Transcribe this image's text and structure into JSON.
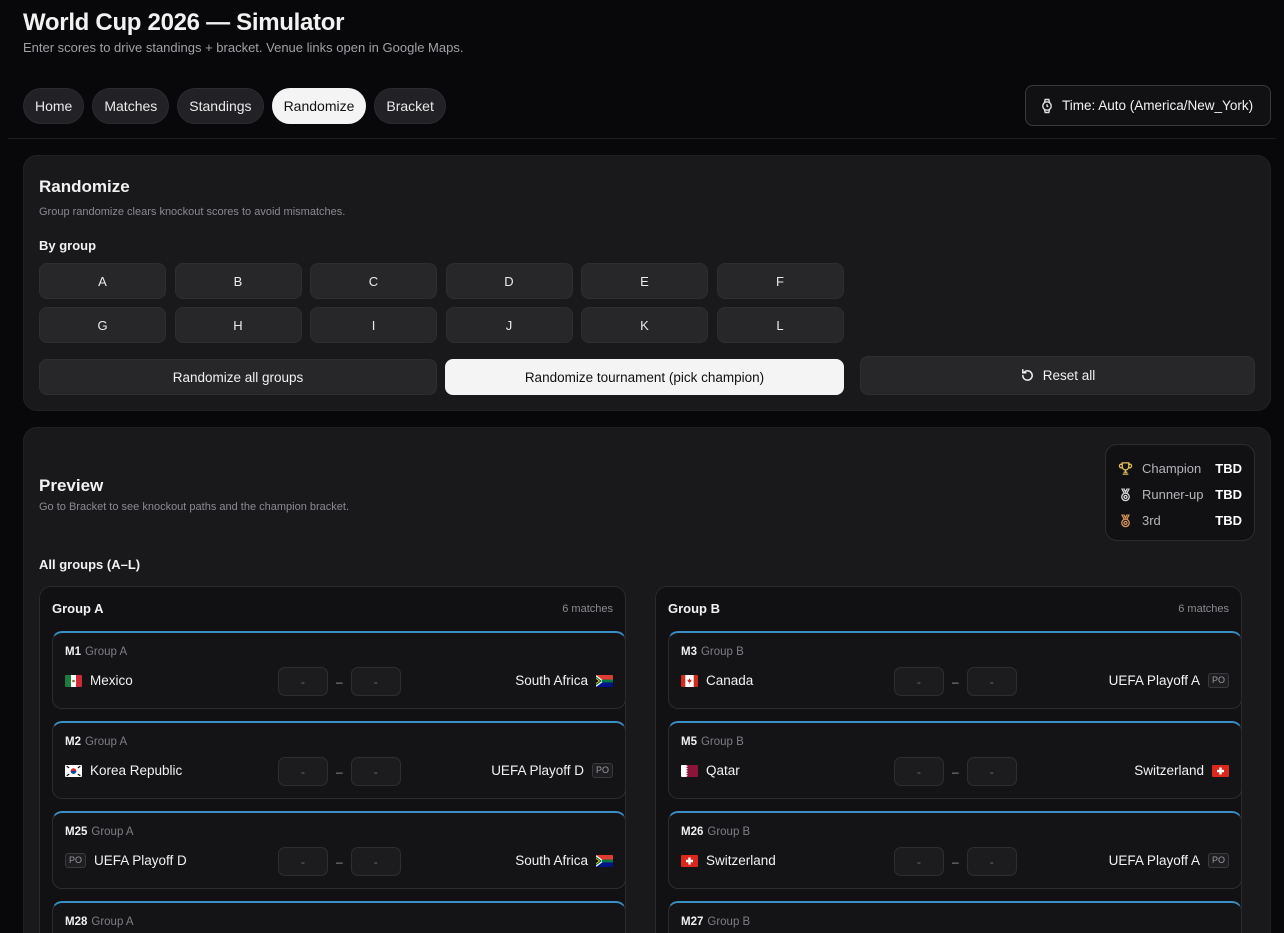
{
  "header": {
    "title": "World Cup 2026 — Simulator",
    "subtitle": "Enter scores to drive standings + bracket. Venue links open in Google Maps."
  },
  "nav": {
    "tabs": [
      "Home",
      "Matches",
      "Standings",
      "Randomize",
      "Bracket"
    ],
    "active": "Randomize"
  },
  "time": {
    "label": "Time: Auto (America/New_York)",
    "icon": "watch-icon"
  },
  "randomize": {
    "title": "Randomize",
    "subtitle": "Group randomize clears knockout scores to avoid mismatches.",
    "by_group_label": "By group",
    "groups": [
      "A",
      "B",
      "C",
      "D",
      "E",
      "F",
      "G",
      "H",
      "I",
      "J",
      "K",
      "L"
    ],
    "all_groups_label": "Randomize all groups",
    "tournament_label": "Randomize tournament (pick champion)",
    "reset_label": "Reset all"
  },
  "preview": {
    "title": "Preview",
    "subtitle": "Go to Bracket to see knockout paths and the champion bracket.",
    "all_groups_label": "All groups (A–L)",
    "awards": [
      {
        "label": "Champion",
        "value": "TBD",
        "icon": "trophy-icon",
        "color": "#e6c25a"
      },
      {
        "label": "Runner-up",
        "value": "TBD",
        "icon": "medal-icon",
        "color": "#d8d8d8"
      },
      {
        "label": "3rd",
        "value": "TBD",
        "icon": "medal-icon",
        "color": "#d9955a"
      }
    ]
  },
  "group_panels": [
    {
      "title": "Group A",
      "count": "6 matches",
      "matches": [
        {
          "id": "M1",
          "group": "Group A",
          "home": "Mexico",
          "home_flag": "mexico",
          "away": "South Africa",
          "away_flag": "south-africa",
          "home_score": "-",
          "away_score": "-"
        },
        {
          "id": "M2",
          "group": "Group A",
          "home": "Korea Republic",
          "home_flag": "korea",
          "away": "UEFA Playoff D",
          "away_flag": "PO",
          "home_score": "-",
          "away_score": "-"
        },
        {
          "id": "M25",
          "group": "Group A",
          "home": "UEFA Playoff D",
          "home_flag": "PO",
          "away": "South Africa",
          "away_flag": "south-africa",
          "home_score": "-",
          "away_score": "-"
        },
        {
          "id": "M28",
          "group": "Group A"
        }
      ]
    },
    {
      "title": "Group B",
      "count": "6 matches",
      "matches": [
        {
          "id": "M3",
          "group": "Group B",
          "home": "Canada",
          "home_flag": "canada",
          "away": "UEFA Playoff A",
          "away_flag": "PO",
          "home_score": "-",
          "away_score": "-"
        },
        {
          "id": "M5",
          "group": "Group B",
          "home": "Qatar",
          "home_flag": "qatar",
          "away": "Switzerland",
          "away_flag": "switzerland",
          "home_score": "-",
          "away_score": "-"
        },
        {
          "id": "M26",
          "group": "Group B",
          "home": "Switzerland",
          "home_flag": "switzerland",
          "away": "UEFA Playoff A",
          "away_flag": "PO",
          "home_score": "-",
          "away_score": "-"
        },
        {
          "id": "M27",
          "group": "Group B"
        }
      ]
    }
  ],
  "colors": {
    "accent": "#3a8fc4",
    "background": "#08080a",
    "card": "#19191c"
  }
}
